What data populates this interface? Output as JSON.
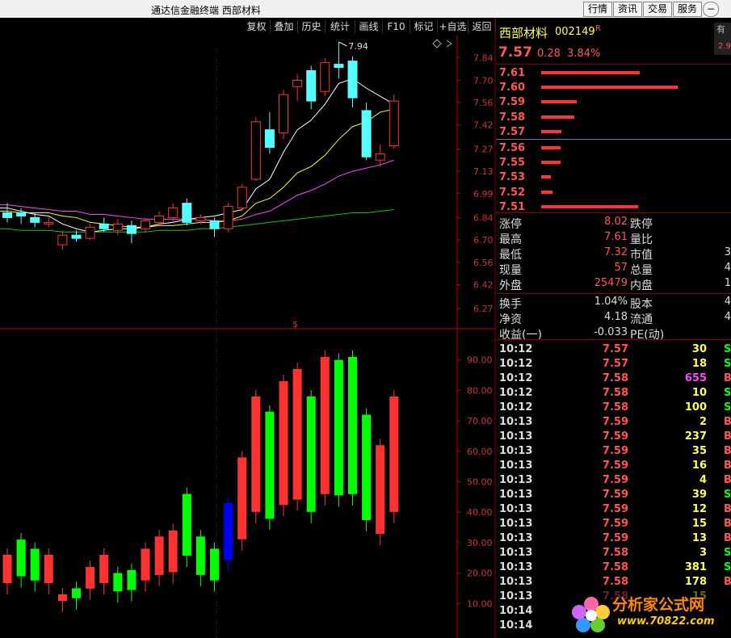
{
  "app_title": "通达信金融终端  西部材料",
  "title_buttons": [
    "行情",
    "资讯",
    "交易",
    "服务"
  ],
  "toolbar": [
    "复权",
    "叠加",
    "历史",
    "统计",
    "画线",
    "F10",
    "标记",
    "+自选",
    "返回"
  ],
  "colors": {
    "up": "#ff3232",
    "down": "#54ffff",
    "vol_down": "#00ff00",
    "vol_special": "#0000ff",
    "ma5": "#ffffff",
    "ma10": "#ffff00",
    "ma20": "#ff44ff",
    "ma60": "#00cc00",
    "axis": "#c00000"
  },
  "price_axis": {
    "min": 6.2,
    "max": 7.98,
    "ticks": [
      "7.84",
      "7.70",
      "7.56",
      "7.42",
      "7.27",
      "7.13",
      "6.99",
      "6.84",
      "6.70",
      "6.56",
      "6.42",
      "6.27"
    ]
  },
  "high_marker": "7.94",
  "vol_axis": {
    "min": 0,
    "max": 100,
    "ticks": [
      "90.00",
      "80.00",
      "70.00",
      "60.00",
      "50.00",
      "40.00",
      "30.00",
      "20.00",
      "10.00"
    ]
  },
  "vol_unit_label": "$",
  "chart_data": {
    "type": "candlestick",
    "candles": [
      {
        "o": 6.87,
        "c": 6.84,
        "h": 6.93,
        "l": 6.81
      },
      {
        "o": 6.87,
        "c": 6.85,
        "h": 6.9,
        "l": 6.8
      },
      {
        "o": 6.84,
        "c": 6.81,
        "h": 6.87,
        "l": 6.78
      },
      {
        "o": 6.81,
        "c": 6.81,
        "h": 6.84,
        "l": 6.78
      },
      {
        "o": 6.67,
        "c": 6.73,
        "h": 6.76,
        "l": 6.64
      },
      {
        "o": 6.73,
        "c": 6.71,
        "h": 6.76,
        "l": 6.69
      },
      {
        "o": 6.71,
        "c": 6.78,
        "h": 6.8,
        "l": 6.7
      },
      {
        "o": 6.8,
        "c": 6.77,
        "h": 6.84,
        "l": 6.75
      },
      {
        "o": 6.76,
        "c": 6.8,
        "h": 6.83,
        "l": 6.73
      },
      {
        "o": 6.79,
        "c": 6.74,
        "h": 6.82,
        "l": 6.68
      },
      {
        "o": 6.77,
        "c": 6.82,
        "h": 6.84,
        "l": 6.75
      },
      {
        "o": 6.81,
        "c": 6.85,
        "h": 6.88,
        "l": 6.79
      },
      {
        "o": 6.84,
        "c": 6.9,
        "h": 6.93,
        "l": 6.81
      },
      {
        "o": 6.93,
        "c": 6.81,
        "h": 6.96,
        "l": 6.79
      },
      {
        "o": 6.82,
        "c": 6.84,
        "h": 6.86,
        "l": 6.8
      },
      {
        "o": 6.82,
        "c": 6.77,
        "h": 6.84,
        "l": 6.72
      },
      {
        "o": 6.77,
        "c": 6.91,
        "h": 6.93,
        "l": 6.75
      },
      {
        "o": 6.9,
        "c": 7.03,
        "h": 7.05,
        "l": 6.88
      },
      {
        "o": 7.08,
        "c": 7.44,
        "h": 7.47,
        "l": 7.07
      },
      {
        "o": 7.39,
        "c": 7.28,
        "h": 7.5,
        "l": 7.24
      },
      {
        "o": 7.37,
        "c": 7.61,
        "h": 7.64,
        "l": 7.33
      },
      {
        "o": 7.66,
        "c": 7.7,
        "h": 7.74,
        "l": 7.57
      },
      {
        "o": 7.76,
        "c": 7.57,
        "h": 7.79,
        "l": 7.52
      },
      {
        "o": 7.63,
        "c": 7.81,
        "h": 7.84,
        "l": 7.6
      },
      {
        "o": 7.8,
        "c": 7.78,
        "h": 7.94,
        "l": 7.71
      },
      {
        "o": 7.82,
        "c": 7.59,
        "h": 7.85,
        "l": 7.53
      },
      {
        "o": 7.51,
        "c": 7.22,
        "h": 7.56,
        "l": 7.2
      },
      {
        "o": 7.2,
        "c": 7.24,
        "h": 7.3,
        "l": 7.16
      },
      {
        "o": 7.29,
        "c": 7.57,
        "h": 7.61,
        "l": 7.27
      }
    ],
    "vol_colors": [
      "r",
      "g",
      "g",
      "r",
      "r",
      "g",
      "r",
      "r",
      "g",
      "g",
      "r",
      "r",
      "r",
      "g",
      "g",
      "g",
      "b",
      "r",
      "r",
      "g",
      "r",
      "r",
      "g",
      "r",
      "g",
      "g",
      "g",
      "r",
      "r"
    ],
    "volumes": [
      26,
      31,
      28,
      26,
      13,
      15,
      22,
      26,
      20,
      21,
      28,
      32,
      34,
      46,
      32,
      28,
      43,
      58,
      78,
      73,
      83,
      87,
      78,
      91,
      90,
      91,
      72,
      62,
      78
    ],
    "ma5": [
      6.9,
      6.88,
      6.86,
      6.85,
      6.8,
      6.77,
      6.75,
      6.76,
      6.77,
      6.77,
      6.78,
      6.8,
      6.81,
      6.83,
      6.84,
      6.85,
      6.87,
      6.89,
      7.02,
      7.08,
      7.25,
      7.39,
      7.45,
      7.55,
      7.68,
      7.71,
      7.65,
      7.6,
      7.55
    ],
    "ma10": [
      6.88,
      6.87,
      6.87,
      6.87,
      6.85,
      6.84,
      6.81,
      6.8,
      6.79,
      6.78,
      6.78,
      6.79,
      6.79,
      6.8,
      6.81,
      6.81,
      6.82,
      6.85,
      6.93,
      6.96,
      7.03,
      7.12,
      7.16,
      7.23,
      7.33,
      7.41,
      7.44,
      7.5,
      7.52
    ],
    "ma20": [
      6.92,
      6.91,
      6.9,
      6.89,
      6.88,
      6.88,
      6.86,
      6.86,
      6.85,
      6.84,
      6.83,
      6.83,
      6.83,
      6.83,
      6.83,
      6.82,
      6.82,
      6.83,
      6.86,
      6.88,
      6.93,
      6.98,
      7.01,
      7.05,
      7.1,
      7.13,
      7.15,
      7.17,
      7.2
    ],
    "ma60": [
      6.77,
      6.76,
      6.76,
      6.76,
      6.75,
      6.75,
      6.75,
      6.75,
      6.75,
      6.75,
      6.75,
      6.76,
      6.76,
      6.76,
      6.77,
      6.77,
      6.78,
      6.79,
      6.8,
      6.81,
      6.82,
      6.83,
      6.84,
      6.85,
      6.86,
      6.87,
      6.87,
      6.88,
      6.89
    ]
  },
  "quote": {
    "name": "西部材料",
    "code": "002149",
    "flag": "R",
    "price": "7.57",
    "change": "0.28",
    "pct": "3.84%",
    "side_label": "有",
    "side_value": "2.9"
  },
  "order_book": {
    "asks": [
      {
        "p": "7.61",
        "v": 0.72
      },
      {
        "p": "7.60",
        "v": 1.0
      },
      {
        "p": "7.59",
        "v": 0.26
      },
      {
        "p": "7.58",
        "v": 0.24
      },
      {
        "p": "7.57",
        "v": 0.15
      }
    ],
    "bids": [
      {
        "p": "7.56",
        "v": 0.14
      },
      {
        "p": "7.55",
        "v": 0.14
      },
      {
        "p": "7.53",
        "v": 0.07
      },
      {
        "p": "7.52",
        "v": 0.08
      },
      {
        "p": "7.51",
        "v": 0.71
      }
    ]
  },
  "stats": [
    {
      "l1": "涨停",
      "v1": "8.02",
      "l2": "跌停",
      "v2": ""
    },
    {
      "l1": "最高",
      "v1": "7.61",
      "l2": "量比",
      "v2": ""
    },
    {
      "l1": "最低",
      "v1": "7.32",
      "l2": "市值",
      "v2": "3"
    },
    {
      "l1": "现量",
      "v1": "57",
      "l2": "总量",
      "v2": "4"
    },
    {
      "l1": "外盘",
      "v1": "25479",
      "l2": "内盘",
      "v2": "1"
    },
    {
      "l1": "换手",
      "v1": "1.04%",
      "l2": "股本",
      "v2": "4"
    },
    {
      "l1": "净资",
      "v1": "4.18",
      "l2": "流通",
      "v2": "4"
    },
    {
      "l1": "收益(一)",
      "v1": "-0.033",
      "l2": "PE(动)",
      "v2": ""
    }
  ],
  "ticks": [
    {
      "t": "10:12",
      "p": "7.57",
      "v": "30",
      "s": "S"
    },
    {
      "t": "10:12",
      "p": "7.57",
      "v": "18",
      "s": "S"
    },
    {
      "t": "10:12",
      "p": "7.58",
      "v": "655",
      "s": "B"
    },
    {
      "t": "10:12",
      "p": "7.58",
      "v": "10",
      "s": "S"
    },
    {
      "t": "10:12",
      "p": "7.58",
      "v": "100",
      "s": "S"
    },
    {
      "t": "10:13",
      "p": "7.59",
      "v": "2",
      "s": "B"
    },
    {
      "t": "10:13",
      "p": "7.59",
      "v": "237",
      "s": "B"
    },
    {
      "t": "10:13",
      "p": "7.59",
      "v": "35",
      "s": "B"
    },
    {
      "t": "10:13",
      "p": "7.59",
      "v": "16",
      "s": "B"
    },
    {
      "t": "10:13",
      "p": "7.59",
      "v": "4",
      "s": "B"
    },
    {
      "t": "10:13",
      "p": "7.59",
      "v": "39",
      "s": "S"
    },
    {
      "t": "10:13",
      "p": "7.59",
      "v": "12",
      "s": "B"
    },
    {
      "t": "10:13",
      "p": "7.59",
      "v": "15",
      "s": "B"
    },
    {
      "t": "10:13",
      "p": "7.59",
      "v": "13",
      "s": "B"
    },
    {
      "t": "10:13",
      "p": "7.58",
      "v": "3",
      "s": "S"
    },
    {
      "t": "10:13",
      "p": "7.58",
      "v": "381",
      "s": "S"
    },
    {
      "t": "10:13",
      "p": "7.58",
      "v": "178",
      "s": "B"
    },
    {
      "t": "10:13",
      "p": "7.58",
      "v": "15",
      "s": ""
    },
    {
      "t": "10:14",
      "p": "",
      "v": "",
      "s": ""
    },
    {
      "t": "10:14",
      "p": "",
      "v": "",
      "s": ""
    }
  ],
  "watermark": {
    "name": "分析家公式网",
    "url": "www.70822.com"
  }
}
